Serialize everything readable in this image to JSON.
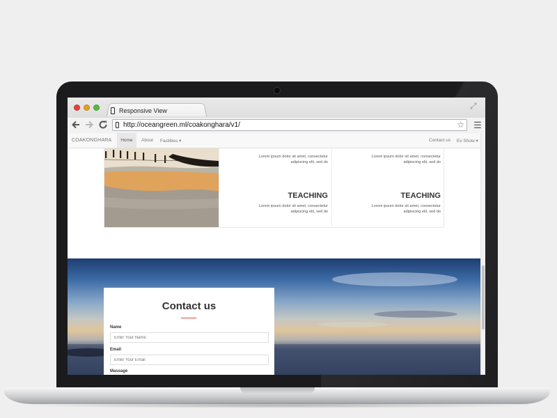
{
  "browser": {
    "tab_title": "Responsive View",
    "url": "http://oceangreen.ml/coakonghara/v1/"
  },
  "site": {
    "brand": "COAKONGHARA",
    "nav": {
      "home": "Home",
      "about": "About",
      "facilities": "Facilities ▾",
      "contact": "Contact us",
      "exshow": "Ex Show ▾"
    }
  },
  "features": [
    {
      "desc_top": "Lorem ipsum dolor sit amet, consectetur adipiscing elit, sed do",
      "title": "TEACHING",
      "desc_bottom": "Lorem ipsum dolor sit amet, consectetur adipiscing elit, sed do"
    },
    {
      "desc_top": "Lorem ipsum dolor sit amet, consectetur adipiscing elit, sed do",
      "title": "TEACHING",
      "desc_bottom": "Lorem ipsum dolor sit amet, consectetur adipiscing elit, sed do"
    }
  ],
  "contact_form": {
    "title": "Contact us",
    "name_label": "Name",
    "name_placeholder": "Enter Your Name",
    "email_label": "Email",
    "email_placeholder": "Enter Your Email",
    "message_label": "Massage"
  },
  "icons": {
    "back": "arrow-left-icon",
    "forward": "arrow-right-icon",
    "reload": "reload-icon",
    "bookmark": "star-icon",
    "menu": "hamburger-menu-icon",
    "fullscreen": "expand-icon",
    "tab": "phone-icon"
  },
  "colors": {
    "accent_rule": "#e04b3a",
    "nav_background": "#f8f8f8"
  }
}
